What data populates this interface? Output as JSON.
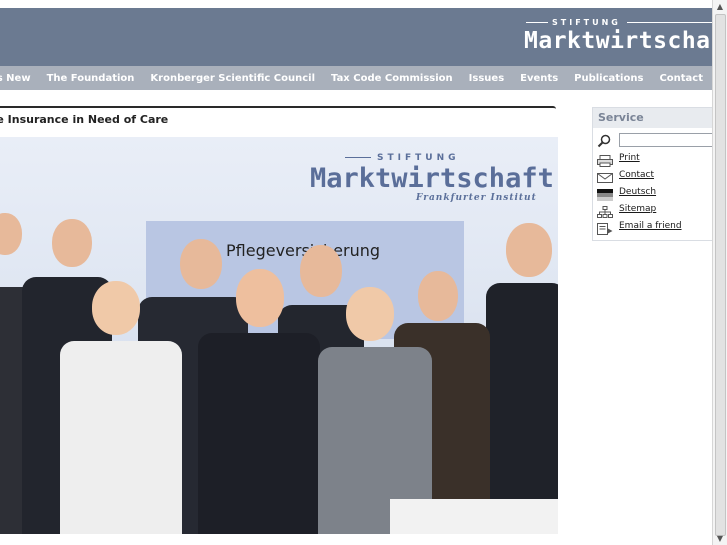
{
  "header": {
    "brand_small": "STIFTUNG",
    "brand_big": "Marktwirtschaft"
  },
  "nav": {
    "items": [
      {
        "label": "What's New"
      },
      {
        "label": "The Foundation"
      },
      {
        "label": "Kronberger Scientific Council"
      },
      {
        "label": "Tax Code Commission"
      },
      {
        "label": "Issues"
      },
      {
        "label": "Events"
      },
      {
        "label": "Publications"
      },
      {
        "label": "Contact"
      }
    ]
  },
  "article": {
    "title": "Long-Term Care Insurance in Need of Care",
    "photo": {
      "backdrop_small": "STIFTUNG",
      "backdrop_brand": "Marktwirtschaft",
      "backdrop_sub": "Frankfurter Institut",
      "banner_text": "Pflegeversicherung"
    }
  },
  "service": {
    "title": "Service",
    "search_value": "",
    "links": [
      {
        "label": "Print",
        "icon": "printer-icon"
      },
      {
        "label": "Contact",
        "icon": "envelope-icon"
      },
      {
        "label": "Deutsch",
        "icon": "german-flag-icon"
      },
      {
        "label": "Sitemap",
        "icon": "sitemap-icon"
      },
      {
        "label": "Email a friend",
        "icon": "email-friend-icon"
      }
    ]
  },
  "colors": {
    "header_bg": "#6b7a91",
    "nav_bg": "#a9b0bb",
    "service_head_bg": "#e8ebef"
  }
}
